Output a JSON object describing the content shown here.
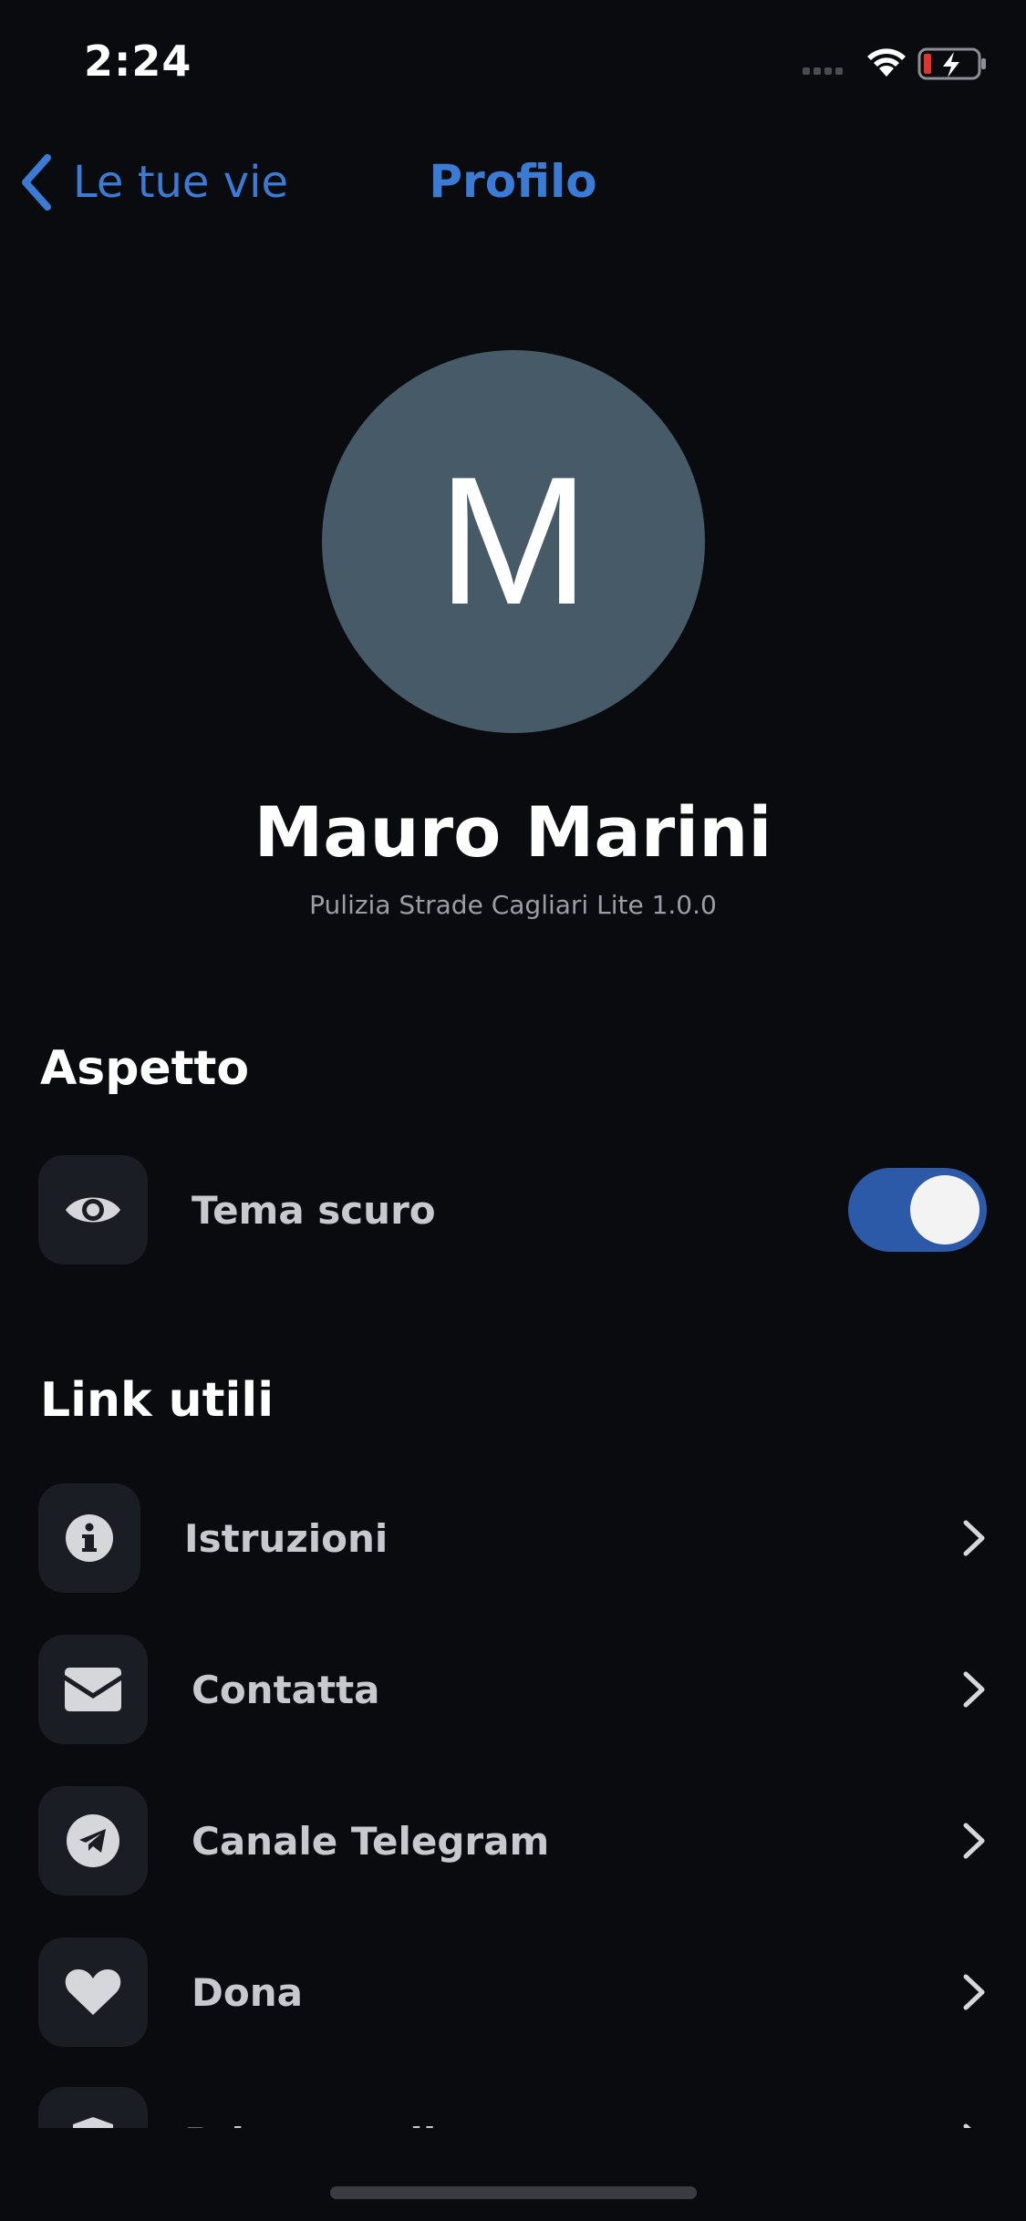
{
  "status_bar": {
    "time": "2:24"
  },
  "nav": {
    "back_label": "Le tue vie",
    "title": "Profilo"
  },
  "profile": {
    "avatar_letter": "M",
    "name": "Mauro Marini",
    "app_version": "Pulizia Strade Cagliari Lite 1.0.0"
  },
  "appearance": {
    "title": "Aspetto",
    "dark_theme": {
      "label": "Tema scuro",
      "icon": "eye-icon",
      "enabled": true
    }
  },
  "links": {
    "title": "Link utili",
    "items": [
      {
        "label": "Istruzioni",
        "icon": "info-icon"
      },
      {
        "label": "Contatta",
        "icon": "envelope-icon"
      },
      {
        "label": "Canale Telegram",
        "icon": "telegram-icon"
      },
      {
        "label": "Dona",
        "icon": "heart-icon"
      },
      {
        "label": "Privacy policy",
        "icon": "shield-icon"
      }
    ]
  },
  "colors": {
    "accent": "#3a7bd5",
    "background": "#0a0b0f",
    "tile": "#1b1d24",
    "avatar": "#465a67",
    "toggle_on": "#2c5aa8"
  }
}
